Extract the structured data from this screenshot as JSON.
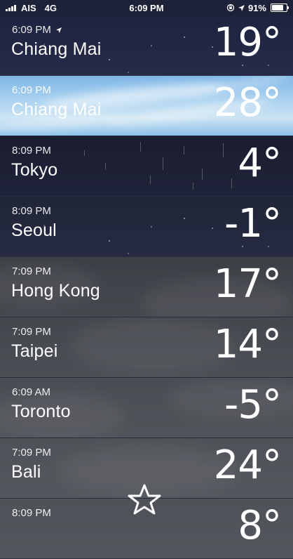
{
  "status_bar": {
    "carrier": "AIS",
    "network": "4G",
    "time": "6:09 PM",
    "battery_percent": "91%",
    "battery_level": 0.91
  },
  "cities": [
    {
      "time": "6:09 PM",
      "name": "Chiang Mai",
      "temp": "19°",
      "current_location": true,
      "condition": "night-clear"
    },
    {
      "time": "6:09 PM",
      "name": "Chiang Mai",
      "temp": "28°",
      "current_location": false,
      "condition": "day-sky"
    },
    {
      "time": "8:09 PM",
      "name": "Tokyo",
      "temp": "4°",
      "current_location": false,
      "condition": "night-rain"
    },
    {
      "time": "8:09 PM",
      "name": "Seoul",
      "temp": "-1°",
      "current_location": false,
      "condition": "night-cloudy"
    },
    {
      "time": "7:09 PM",
      "name": "Hong Kong",
      "temp": "17°",
      "current_location": false,
      "condition": "cloudy"
    },
    {
      "time": "7:09 PM",
      "name": "Taipei",
      "temp": "14°",
      "current_location": false,
      "condition": "cloudy"
    },
    {
      "time": "6:09 AM",
      "name": "Toronto",
      "temp": "-5°",
      "current_location": false,
      "condition": "cloudy"
    },
    {
      "time": "7:09 PM",
      "name": "Bali",
      "temp": "24°",
      "current_location": false,
      "condition": "cloudy"
    },
    {
      "time": "8:09 PM",
      "name": "",
      "temp": "8°",
      "current_location": false,
      "condition": "cloudy"
    }
  ],
  "icons": {
    "location": "location-arrow-icon",
    "star": "star-icon",
    "lock": "orientation-lock-icon"
  }
}
